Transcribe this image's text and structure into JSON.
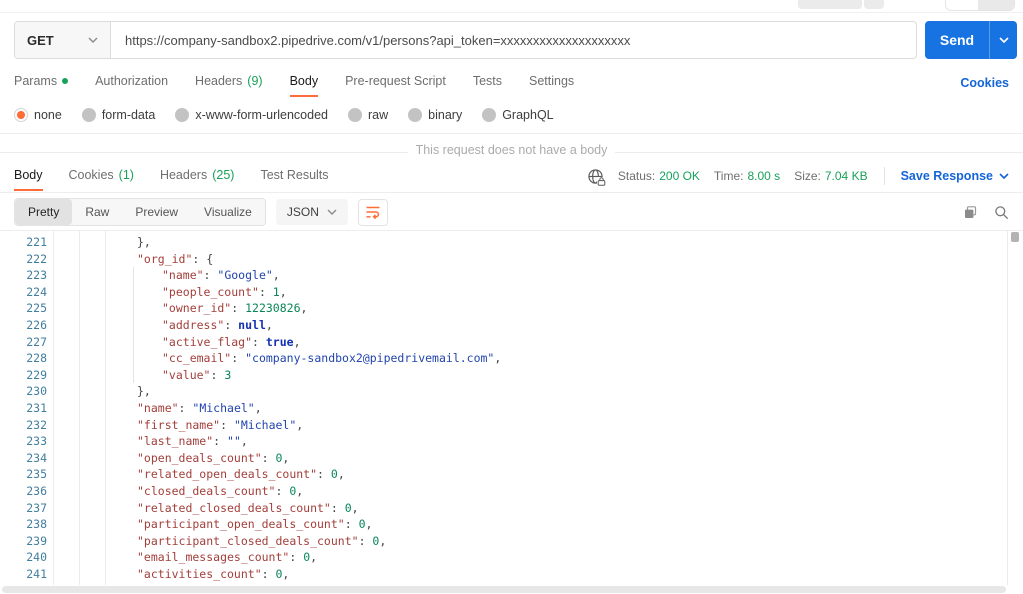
{
  "request": {
    "method": "GET",
    "url": "https://company-sandbox2.pipedrive.com/v1/persons?api_token=xxxxxxxxxxxxxxxxxxxx",
    "send_label": "Send",
    "cookies_link": "Cookies",
    "tabs": [
      {
        "label": "Params",
        "has_dot": true
      },
      {
        "label": "Authorization"
      },
      {
        "label": "Headers",
        "count": "(9)"
      },
      {
        "label": "Body",
        "active": true
      },
      {
        "label": "Pre-request Script"
      },
      {
        "label": "Tests"
      },
      {
        "label": "Settings"
      }
    ],
    "body_types": [
      "none",
      "form-data",
      "x-www-form-urlencoded",
      "raw",
      "binary",
      "GraphQL"
    ],
    "selected_body_type": "none",
    "empty_body_message": "This request does not have a body"
  },
  "response": {
    "tabs": [
      {
        "label": "Body",
        "active": true
      },
      {
        "label": "Cookies",
        "count": "(1)"
      },
      {
        "label": "Headers",
        "count": "(25)"
      },
      {
        "label": "Test Results"
      }
    ],
    "meta": {
      "status_label": "Status:",
      "status_value": "200 OK",
      "time_label": "Time:",
      "time_value": "8.00 s",
      "size_label": "Size:",
      "size_value": "7.04 KB"
    },
    "save_response_label": "Save Response",
    "view_tabs": [
      "Pretty",
      "Raw",
      "Preview",
      "Visualize"
    ],
    "active_view": "Pretty",
    "format": "JSON"
  },
  "code": {
    "lines": [
      {
        "num": 221,
        "indent": 1,
        "tokens": [
          {
            "t": "p",
            "v": "},"
          }
        ]
      },
      {
        "num": 222,
        "indent": 1,
        "tokens": [
          {
            "t": "k",
            "v": "\"org_id\""
          },
          {
            "t": "p",
            "v": ": {"
          }
        ]
      },
      {
        "num": 223,
        "indent": 2,
        "tokens": [
          {
            "t": "k",
            "v": "\"name\""
          },
          {
            "t": "p",
            "v": ": "
          },
          {
            "t": "s",
            "v": "\"Google\""
          },
          {
            "t": "p",
            "v": ","
          }
        ]
      },
      {
        "num": 224,
        "indent": 2,
        "tokens": [
          {
            "t": "k",
            "v": "\"people_count\""
          },
          {
            "t": "p",
            "v": ": "
          },
          {
            "t": "n",
            "v": "1"
          },
          {
            "t": "p",
            "v": ","
          }
        ]
      },
      {
        "num": 225,
        "indent": 2,
        "tokens": [
          {
            "t": "k",
            "v": "\"owner_id\""
          },
          {
            "t": "p",
            "v": ": "
          },
          {
            "t": "n",
            "v": "12230826"
          },
          {
            "t": "p",
            "v": ","
          }
        ]
      },
      {
        "num": 226,
        "indent": 2,
        "tokens": [
          {
            "t": "k",
            "v": "\"address\""
          },
          {
            "t": "p",
            "v": ": "
          },
          {
            "t": "b",
            "v": "null"
          },
          {
            "t": "p",
            "v": ","
          }
        ]
      },
      {
        "num": 227,
        "indent": 2,
        "tokens": [
          {
            "t": "k",
            "v": "\"active_flag\""
          },
          {
            "t": "p",
            "v": ": "
          },
          {
            "t": "b",
            "v": "true"
          },
          {
            "t": "p",
            "v": ","
          }
        ]
      },
      {
        "num": 228,
        "indent": 2,
        "tokens": [
          {
            "t": "k",
            "v": "\"cc_email\""
          },
          {
            "t": "p",
            "v": ": "
          },
          {
            "t": "s",
            "v": "\"company-sandbox2@pipedrivemail.com\""
          },
          {
            "t": "p",
            "v": ","
          }
        ]
      },
      {
        "num": 229,
        "indent": 2,
        "tokens": [
          {
            "t": "k",
            "v": "\"value\""
          },
          {
            "t": "p",
            "v": ": "
          },
          {
            "t": "n",
            "v": "3"
          }
        ]
      },
      {
        "num": 230,
        "indent": 1,
        "tokens": [
          {
            "t": "p",
            "v": "},"
          }
        ]
      },
      {
        "num": 231,
        "indent": 1,
        "tokens": [
          {
            "t": "k",
            "v": "\"name\""
          },
          {
            "t": "p",
            "v": ": "
          },
          {
            "t": "s",
            "v": "\"Michael\""
          },
          {
            "t": "p",
            "v": ","
          }
        ]
      },
      {
        "num": 232,
        "indent": 1,
        "tokens": [
          {
            "t": "k",
            "v": "\"first_name\""
          },
          {
            "t": "p",
            "v": ": "
          },
          {
            "t": "s",
            "v": "\"Michael\""
          },
          {
            "t": "p",
            "v": ","
          }
        ]
      },
      {
        "num": 233,
        "indent": 1,
        "tokens": [
          {
            "t": "k",
            "v": "\"last_name\""
          },
          {
            "t": "p",
            "v": ": "
          },
          {
            "t": "s",
            "v": "\"\""
          },
          {
            "t": "p",
            "v": ","
          }
        ]
      },
      {
        "num": 234,
        "indent": 1,
        "tokens": [
          {
            "t": "k",
            "v": "\"open_deals_count\""
          },
          {
            "t": "p",
            "v": ": "
          },
          {
            "t": "n",
            "v": "0"
          },
          {
            "t": "p",
            "v": ","
          }
        ]
      },
      {
        "num": 235,
        "indent": 1,
        "tokens": [
          {
            "t": "k",
            "v": "\"related_open_deals_count\""
          },
          {
            "t": "p",
            "v": ": "
          },
          {
            "t": "n",
            "v": "0"
          },
          {
            "t": "p",
            "v": ","
          }
        ]
      },
      {
        "num": 236,
        "indent": 1,
        "tokens": [
          {
            "t": "k",
            "v": "\"closed_deals_count\""
          },
          {
            "t": "p",
            "v": ": "
          },
          {
            "t": "n",
            "v": "0"
          },
          {
            "t": "p",
            "v": ","
          }
        ]
      },
      {
        "num": 237,
        "indent": 1,
        "tokens": [
          {
            "t": "k",
            "v": "\"related_closed_deals_count\""
          },
          {
            "t": "p",
            "v": ": "
          },
          {
            "t": "n",
            "v": "0"
          },
          {
            "t": "p",
            "v": ","
          }
        ]
      },
      {
        "num": 238,
        "indent": 1,
        "tokens": [
          {
            "t": "k",
            "v": "\"participant_open_deals_count\""
          },
          {
            "t": "p",
            "v": ": "
          },
          {
            "t": "n",
            "v": "0"
          },
          {
            "t": "p",
            "v": ","
          }
        ]
      },
      {
        "num": 239,
        "indent": 1,
        "tokens": [
          {
            "t": "k",
            "v": "\"participant_closed_deals_count\""
          },
          {
            "t": "p",
            "v": ": "
          },
          {
            "t": "n",
            "v": "0"
          },
          {
            "t": "p",
            "v": ","
          }
        ]
      },
      {
        "num": 240,
        "indent": 1,
        "tokens": [
          {
            "t": "k",
            "v": "\"email_messages_count\""
          },
          {
            "t": "p",
            "v": ": "
          },
          {
            "t": "n",
            "v": "0"
          },
          {
            "t": "p",
            "v": ","
          }
        ]
      },
      {
        "num": 241,
        "indent": 1,
        "tokens": [
          {
            "t": "k",
            "v": "\"activities_count\""
          },
          {
            "t": "p",
            "v": ": "
          },
          {
            "t": "n",
            "v": "0"
          },
          {
            "t": "p",
            "v": ","
          }
        ]
      }
    ]
  },
  "colors": {
    "accent_orange": "#ff6c37",
    "success_green": "#18a15a",
    "link_blue": "#1465d8",
    "send_button_blue": "#1673e1",
    "line_number_teal": "#417e9e",
    "json_key": "#a33f3b",
    "json_string": "#2244ad",
    "json_number": "#098658",
    "json_keyword": "#1431b4"
  }
}
